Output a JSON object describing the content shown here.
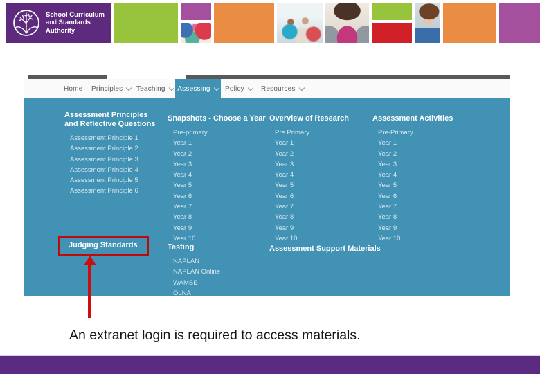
{
  "logo": {
    "line1": "School Curriculum",
    "line2_regular": "and ",
    "line2_bold": "Standards",
    "line3": "Authority"
  },
  "nav": {
    "items": [
      {
        "label": "Home"
      },
      {
        "label": "Principles"
      },
      {
        "label": "Teaching"
      },
      {
        "label": "Assessing"
      },
      {
        "label": "Policy"
      },
      {
        "label": "Resources"
      }
    ],
    "active_item": "Assessing"
  },
  "menu": {
    "columns": [
      {
        "sections": [
          {
            "heading": "Assessment Principles and Reflective Questions",
            "items": [
              "Assessment Principle 1",
              "Assessment Principle 2",
              "Assessment Principle 3",
              "Assessment Principle 4",
              "Assessment Principle 5",
              "Assessment Principle 6"
            ]
          },
          {
            "heading": "Judging Standards",
            "items": []
          }
        ]
      },
      {
        "sections": [
          {
            "heading": "Snapshots - Choose a Year",
            "items": [
              "Pre-primary",
              "Year 1",
              "Year 2",
              "Year 3",
              "Year 4",
              "Year 5",
              "Year 6",
              "Year 7",
              "Year 8",
              "Year 9",
              "Year 10"
            ]
          },
          {
            "heading": "Testing",
            "items": [
              "NAPLAN",
              "NAPLAN Online",
              "WAMSE",
              "OLNA"
            ]
          }
        ]
      },
      {
        "sections": [
          {
            "heading": "Overview of Research",
            "items": [
              "Pre Primary",
              "Year 1",
              "Year 2",
              "Year 3",
              "Year 4",
              "Year 5",
              "Year 6",
              "Year 7",
              "Year 8",
              "Year 9",
              "Year 10"
            ]
          },
          {
            "heading": "Assessment Support Materials",
            "items": []
          }
        ]
      },
      {
        "sections": [
          {
            "heading": "Assessment Activities",
            "items": [
              "Pre-Primary",
              "Year 1",
              "Year 2",
              "Year 3",
              "Year 4",
              "Year 5",
              "Year 6",
              "Year 7",
              "Year 8",
              "Year 9",
              "Year 10"
            ]
          }
        ]
      }
    ]
  },
  "annotation": {
    "target": "Judging Standards"
  },
  "caption": {
    "text": "An extranet login is required to access materials."
  },
  "colors": {
    "menu_teal": "#4192B4",
    "brand_purple": "#5E2A7E",
    "footer_purple": "#5A2B81",
    "tile_green": "#98C33C",
    "tile_orange": "#EA8C43",
    "tile_red": "#D02128",
    "tile_magenta": "#A4509C",
    "annotation_red": "#CC0E0E",
    "topbar_gray": "#58595B"
  }
}
